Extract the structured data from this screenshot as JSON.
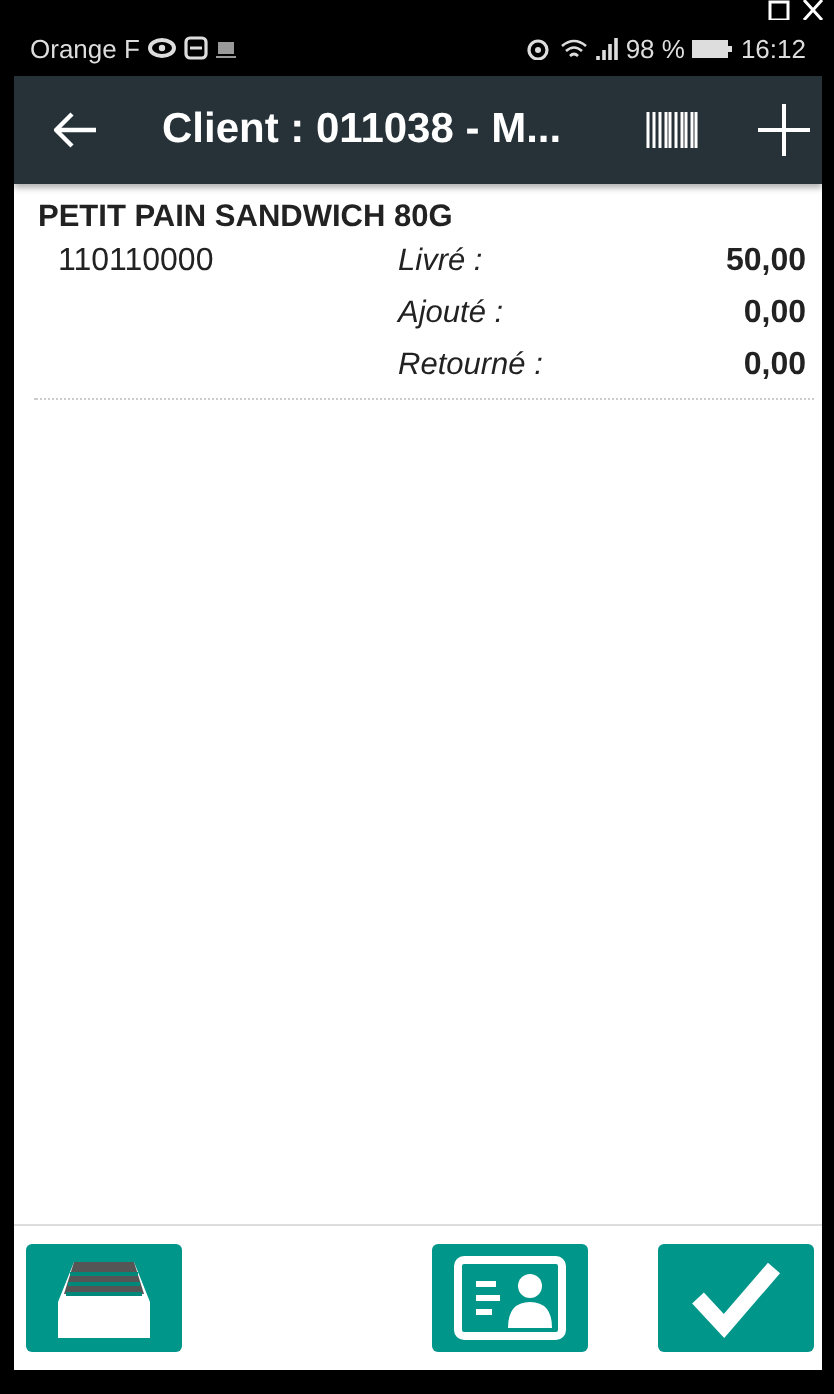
{
  "status_bar": {
    "carrier": "Orange F",
    "battery_text": "98 %",
    "time": "16:12"
  },
  "app_bar": {
    "title": "Client : 011038 - M..."
  },
  "items": [
    {
      "name": "PETIT PAIN SANDWICH 80G",
      "code": "110110000",
      "quantities": [
        {
          "label": "Livré :",
          "value": "50,00"
        },
        {
          "label": "Ajouté :",
          "value": "0,00"
        },
        {
          "label": "Retourné :",
          "value": "0,00"
        }
      ]
    }
  ],
  "bottom_buttons": [
    {
      "kind": "drawer"
    },
    {
      "kind": "spacer"
    },
    {
      "kind": "contact"
    },
    {
      "kind": "confirm"
    }
  ]
}
